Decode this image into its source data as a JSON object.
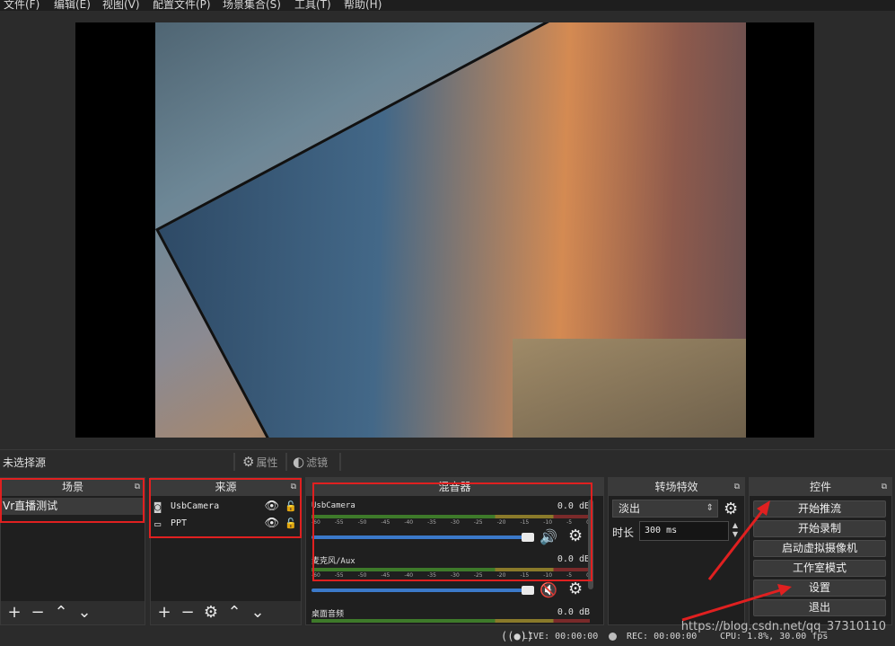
{
  "menu": [
    "文件(F)",
    "编辑(E)",
    "视图(V)",
    "配置文件(P)",
    "场景集合(S)",
    "工具(T)",
    "帮助(H)"
  ],
  "toolbar": {
    "no_source": "未选择源",
    "properties": "属性",
    "filters": "滤镜"
  },
  "scenes": {
    "title": "场景",
    "items": [
      "Vr直播测试"
    ]
  },
  "sources": {
    "title": "来源",
    "items": [
      "UsbCamera",
      "PPT"
    ]
  },
  "mixer": {
    "title": "混音器",
    "channels": [
      {
        "name": "UsbCamera",
        "db": "0.0 dB",
        "volume": 0.95,
        "muted": false
      },
      {
        "name": "麦克风/Aux",
        "db": "0.0 dB",
        "volume": 0.95,
        "muted": true
      },
      {
        "name": "桌面音频",
        "db": "0.0 dB"
      }
    ],
    "ticks": [
      "-60",
      "-55",
      "-50",
      "-45",
      "-40",
      "-35",
      "-30",
      "-25",
      "-20",
      "-15",
      "-10",
      "-5",
      "0"
    ]
  },
  "transitions": {
    "title": "转场特效",
    "selected": "淡出",
    "duration_label": "时长",
    "duration_value": "300 ms"
  },
  "controls": {
    "title": "控件",
    "buttons": [
      "开始推流",
      "开始录制",
      "启动虚拟摄像机",
      "工作室模式",
      "设置",
      "退出"
    ]
  },
  "status": {
    "live": "LIVE: 00:00:00",
    "rec": "REC: 00:00:00",
    "cpu": "CPU: 1.8%, 30.00 fps"
  },
  "watermark": "https://blog.csdn.net/qq_37310110",
  "colors": {
    "annotation": "#e02020",
    "volume_bar": "#3b79c9",
    "mute_icon": "#d52020"
  }
}
